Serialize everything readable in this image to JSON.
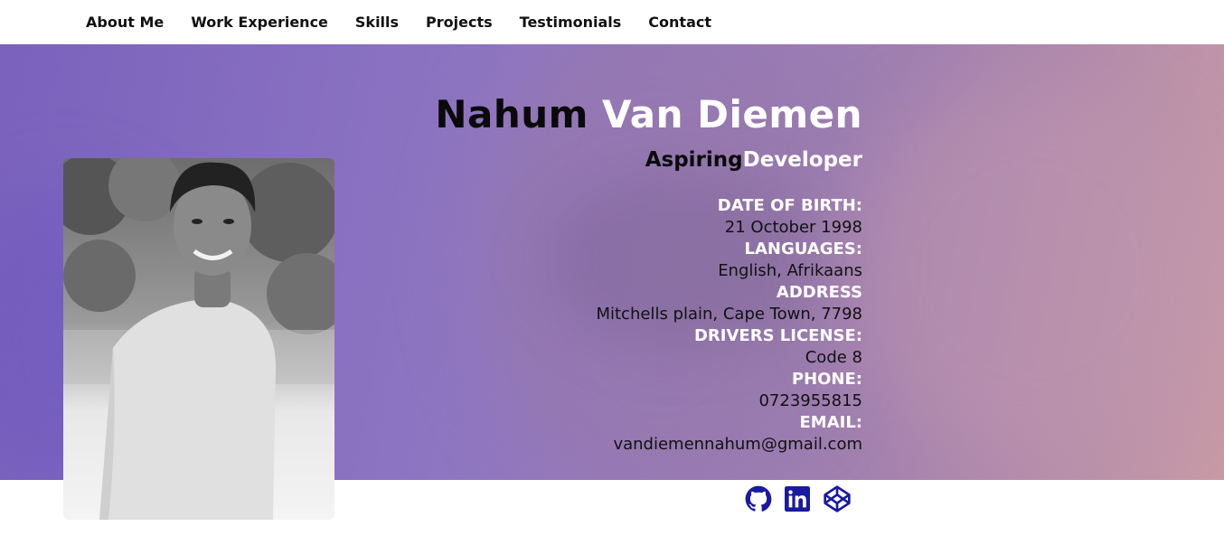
{
  "nav": {
    "items": [
      {
        "label": "About Me"
      },
      {
        "label": "Work Experience"
      },
      {
        "label": "Skills"
      },
      {
        "label": "Projects"
      },
      {
        "label": "Testimonials"
      },
      {
        "label": "Contact"
      }
    ]
  },
  "hero": {
    "first_name": "Nahum",
    "last_name": "Van Diemen",
    "subtitle_dark": "Aspiring",
    "subtitle_light": "Developer",
    "details": [
      {
        "label": "DATE OF BIRTH:",
        "value": "21 October 1998"
      },
      {
        "label": "LANGUAGES:",
        "value": "English, Afrikaans"
      },
      {
        "label": "ADDRESS",
        "value": "Mitchells plain, Cape Town, 7798"
      },
      {
        "label": "DRIVERS LICENSE:",
        "value": "Code 8"
      },
      {
        "label": "PHONE:",
        "value": "0723955815"
      },
      {
        "label": "EMAIL:",
        "value": "vandiemennahum@gmail.com"
      }
    ]
  },
  "socials": [
    {
      "icon": "github-icon"
    },
    {
      "icon": "linkedin-icon"
    },
    {
      "icon": "codepen-icon"
    }
  ],
  "colors": {
    "accent_icon": "#1a1aa0",
    "hero_gradient_start": "#7a62bd",
    "hero_gradient_end": "#c89aa6"
  }
}
